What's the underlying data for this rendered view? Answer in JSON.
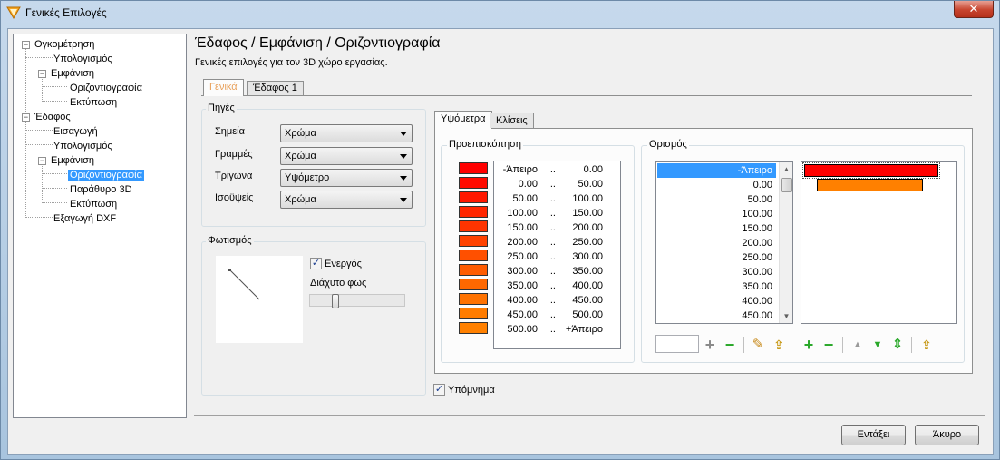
{
  "window": {
    "title": "Γενικές Επιλογές",
    "close_glyph": "✕"
  },
  "tree": {
    "items": [
      {
        "label": "Ογκομέτρηση",
        "expander": "−"
      },
      {
        "label": "Υπολογισμός"
      },
      {
        "label": "Εμφάνιση",
        "expander": "−"
      },
      {
        "label": "Οριζοντιογραφία"
      },
      {
        "label": "Εκτύπωση"
      },
      {
        "label": "Έδαφος",
        "expander": "−"
      },
      {
        "label": "Εισαγωγή"
      },
      {
        "label": "Υπολογισμός"
      },
      {
        "label": "Εμφάνιση",
        "expander": "−"
      },
      {
        "label": "Οριζοντιογραφία",
        "selected": true
      },
      {
        "label": "Παράθυρο 3D"
      },
      {
        "label": "Εκτύπωση"
      },
      {
        "label": "Εξαγωγή DXF"
      }
    ]
  },
  "header": {
    "title": "Έδαφος / Εμφάνιση / Οριζοντιογραφία",
    "subtitle": "Γενικές επιλογές για τον 3D χώρο εργασίας."
  },
  "tabs": {
    "general": "Γενικά",
    "ground1": "Έδαφος 1"
  },
  "sources": {
    "title": "Πηγές",
    "rows": [
      {
        "label": "Σημεία",
        "value": "Χρώμα"
      },
      {
        "label": "Γραμμές",
        "value": "Χρώμα"
      },
      {
        "label": "Τρίγωνα",
        "value": "Υψόμετρο"
      },
      {
        "label": "Ισοϋψείς",
        "value": "Χρώμα"
      }
    ]
  },
  "lighting": {
    "title": "Φωτισμός",
    "enabled_label": "Ενεργός",
    "enabled": true,
    "check_glyph": "✓",
    "diffuse_label": "Διάχυτο φως",
    "diffuse_level": 0.25
  },
  "subtabs": {
    "elevations": "Υψόμετρα",
    "slopes": "Κλίσεις"
  },
  "preview": {
    "title": "Προεπισκόπηση",
    "sep": "..",
    "rows": [
      {
        "from": "-Άπειρο",
        "to": "0.00",
        "color": "#ff0000"
      },
      {
        "from": "0.00",
        "to": "50.00",
        "color": "#ff0a00"
      },
      {
        "from": "50.00",
        "to": "100.00",
        "color": "#ff1800"
      },
      {
        "from": "100.00",
        "to": "150.00",
        "color": "#ff2600"
      },
      {
        "from": "150.00",
        "to": "200.00",
        "color": "#ff3400"
      },
      {
        "from": "200.00",
        "to": "250.00",
        "color": "#ff4200"
      },
      {
        "from": "250.00",
        "to": "300.00",
        "color": "#ff5000"
      },
      {
        "from": "300.00",
        "to": "350.00",
        "color": "#ff5c00"
      },
      {
        "from": "350.00",
        "to": "400.00",
        "color": "#ff6800"
      },
      {
        "from": "400.00",
        "to": "450.00",
        "color": "#ff7200"
      },
      {
        "from": "450.00",
        "to": "500.00",
        "color": "#ff7c00"
      },
      {
        "from": "500.00",
        "to": "+Άπειρο",
        "color": "#ff8000"
      }
    ]
  },
  "definition": {
    "title": "Ορισμός",
    "values": [
      "-Άπειρο",
      "0.00",
      "50.00",
      "100.00",
      "150.00",
      "200.00",
      "250.00",
      "300.00",
      "350.00",
      "400.00",
      "450.00"
    ],
    "selected_index": 0,
    "input_value": "",
    "colors": [
      "#ff0000",
      "#ff8000"
    ],
    "icons": {
      "add": "+",
      "remove": "−",
      "edit": "✎",
      "import": "⇪",
      "up": "▲",
      "down": "▼",
      "updown": "⇕"
    }
  },
  "legend": {
    "label": "Υπόμνημα",
    "checked": true
  },
  "buttons": {
    "ok": "Εντάξει",
    "cancel": "Άκυρο"
  }
}
